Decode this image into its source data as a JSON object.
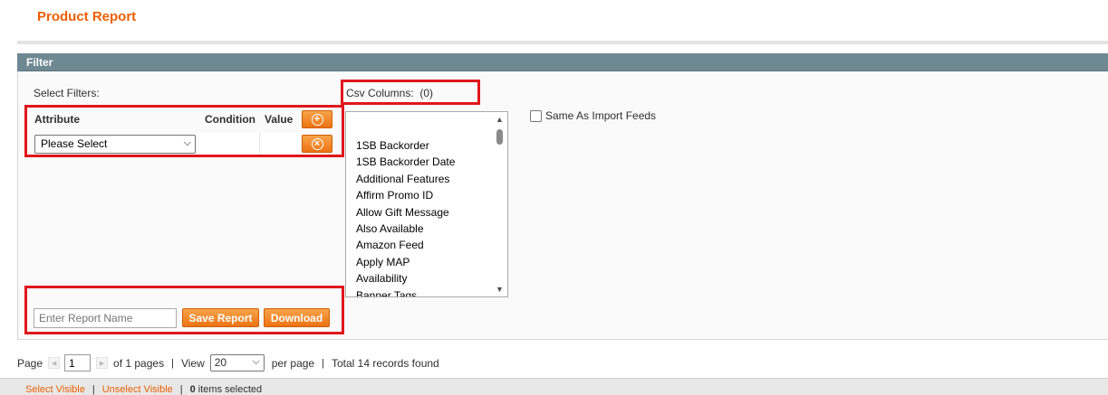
{
  "page": {
    "title": "Product Report"
  },
  "filter": {
    "header": "Filter",
    "select_filters_label": "Select Filters:",
    "columns": {
      "attribute": "Attribute",
      "condition": "Condition",
      "value": "Value"
    },
    "attribute_select_value": "Please Select",
    "add_icon": "plus-circle-icon",
    "remove_icon": "x-circle-icon"
  },
  "csv": {
    "label": "Csv Columns:",
    "count": "(0)",
    "items": [
      "1SB Backorder",
      "1SB Backorder Date",
      "Additional Features",
      "Affirm Promo ID",
      "Allow Gift Message",
      "Also Available",
      "Amazon Feed",
      "Apply MAP",
      "Availability",
      "Banner Tags"
    ],
    "same_as_import_label": "Same As Import Feeds",
    "same_as_import_checked": false
  },
  "report": {
    "name_placeholder": "Enter Report Name",
    "save_label": "Save Report",
    "download_label": "Download"
  },
  "pager": {
    "page_label": "Page",
    "page_value": "1",
    "of_pages": "of 1 pages",
    "view_label": "View",
    "view_value": "20",
    "per_page": "per page",
    "total": "Total 14 records found"
  },
  "massaction": {
    "select_visible": "Select Visible",
    "unselect_visible": "Unselect Visible",
    "selected_count": "0",
    "selected_suffix": " items selected"
  },
  "colors": {
    "accent": "#eb5e00",
    "header_bar": "#6f8992",
    "highlight": "#e0161b",
    "button": "#ec7313"
  }
}
